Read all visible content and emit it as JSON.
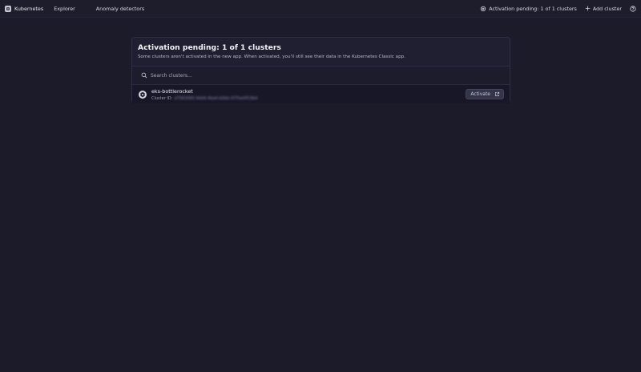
{
  "topbar": {
    "app_name": "Kubernetes",
    "nav": [
      "Explorer",
      "Anomaly detectors"
    ],
    "activation_status": "Activation pending: 1 of 1 clusters",
    "add_cluster": "Add cluster"
  },
  "panel": {
    "title": "Activation pending: 1 of 1 clusters",
    "subtitle": "Some clusters aren't activated in the new app. When activated, you'll still see their data in the Kubernetes Classic app.",
    "search_placeholder": "Search clusters...",
    "clusters": [
      {
        "name": "eks-bottlerocket",
        "id_label": "Cluster ID:",
        "id_value": "a7583060-9dd4-4ba4-b0bb-5f7fae0f19b4",
        "action": "Activate"
      }
    ]
  },
  "colors": {
    "background": "#1b1b2a",
    "panel": "#1f1f31",
    "button": "#34344a"
  }
}
